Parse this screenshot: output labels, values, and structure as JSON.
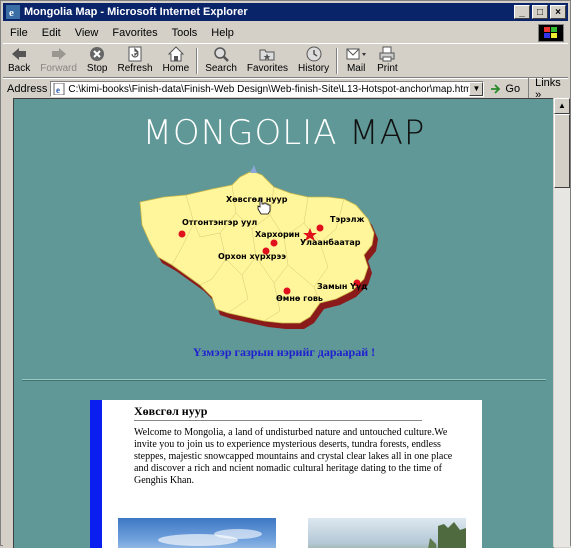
{
  "window": {
    "title": "Mongolia Map - Microsoft Internet Explorer"
  },
  "menu": [
    "File",
    "Edit",
    "View",
    "Favorites",
    "Tools",
    "Help"
  ],
  "toolbar": {
    "back": "Back",
    "forward": "Forward",
    "stop": "Stop",
    "refresh": "Refresh",
    "home": "Home",
    "search": "Search",
    "favorites": "Favorites",
    "history": "History",
    "mail": "Mail",
    "print": "Print"
  },
  "address": {
    "label": "Address",
    "url": "C:\\kimi-books\\Finish-data\\Finish-Web Design\\Web-finish-Site\\L13-Hotspot-anchor\\map.htm",
    "go": "Go",
    "links": "Links"
  },
  "page": {
    "heading_part1": "MONGOLIA",
    "heading_part2": "MAP",
    "map_labels": {
      "khuvsgul": "Хөвсгөл нуур",
      "otgontenger": "Отгонтэнгэр уул",
      "terelj": "Тэрэлж",
      "kharkhorin": "Хархорин",
      "ulaanbaatar": "Улаанбаатар",
      "orkhon": "Орхон хүрхрээ",
      "zamyn_uud": "Замын Үүд",
      "umnugovi": "Өмнө говь"
    },
    "instruction": "Үзмээр газрын нэрийг дараарай !",
    "card": {
      "title": "Хөвсгөл нуур",
      "text": "Welcome to Mongolia, a land of undisturbed nature and untouched culture.We invite you to join us to experience mysterious deserts, tundra forests, endless steppes, majestic snowcapped mountains and crystal clear lakes all in one place and discover a rich and ncient nomadic cultural heritage dating to the time of Genghis Khan."
    }
  },
  "colors": {
    "titlebar": "#0a246a",
    "page_bg": "#5f9896",
    "map_fill": "#fff59a",
    "map_shadow": "#8b1a1a",
    "dot": "#e0101c",
    "instruction": "#2020d0",
    "card_bar": "#0a1ef0"
  }
}
